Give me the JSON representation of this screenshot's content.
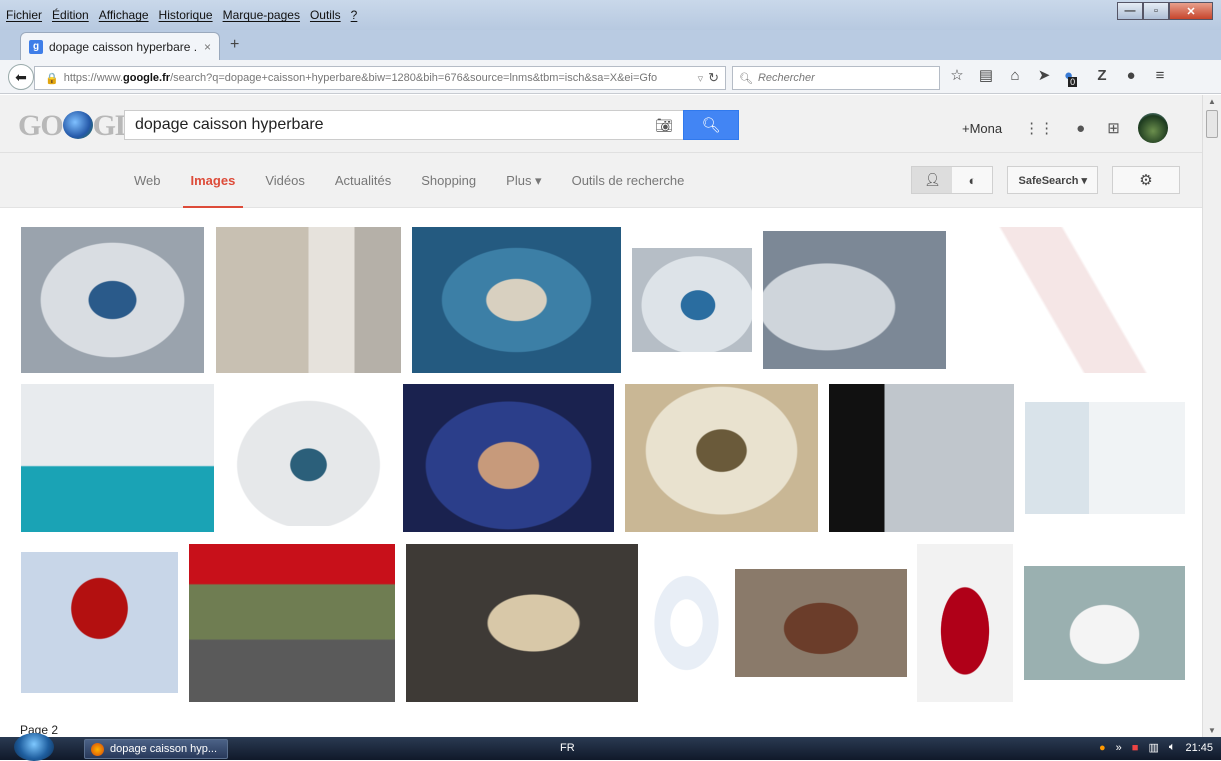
{
  "menubar": {
    "items": [
      "Fichier",
      "Édition",
      "Affichage",
      "Historique",
      "Marque-pages",
      "Outils",
      "?"
    ]
  },
  "browser": {
    "tab_title": "dopage caisson hyperbare ...",
    "tab_close": "×",
    "new_tab": "+",
    "url_prefix": "https://www.",
    "url_domain": "google.fr",
    "url_rest": "/search?q=dopage+caisson+hyperbare&biw=1280&bih=676&source=lnms&tbm=isch&sa=X&ei=Gfo",
    "search_placeholder": "Rechercher",
    "notif_count": "0"
  },
  "google": {
    "logo": "GO",
    "logo_tail": "GLE",
    "query": "dopage caisson hyperbare",
    "user": "+Mona",
    "tabs": [
      "Web",
      "Images",
      "Vidéos",
      "Actualités",
      "Shopping",
      "Plus ▾",
      "Outils de recherche"
    ],
    "safesearch": "SafeSearch ▾",
    "page_label": "Page 2"
  },
  "taskbar": {
    "app_label": "dopage caisson hyp...",
    "lang": "FR",
    "clock": "21:45"
  },
  "colors": {
    "accent_red": "#dd4b39",
    "google_blue": "#4285f4"
  }
}
